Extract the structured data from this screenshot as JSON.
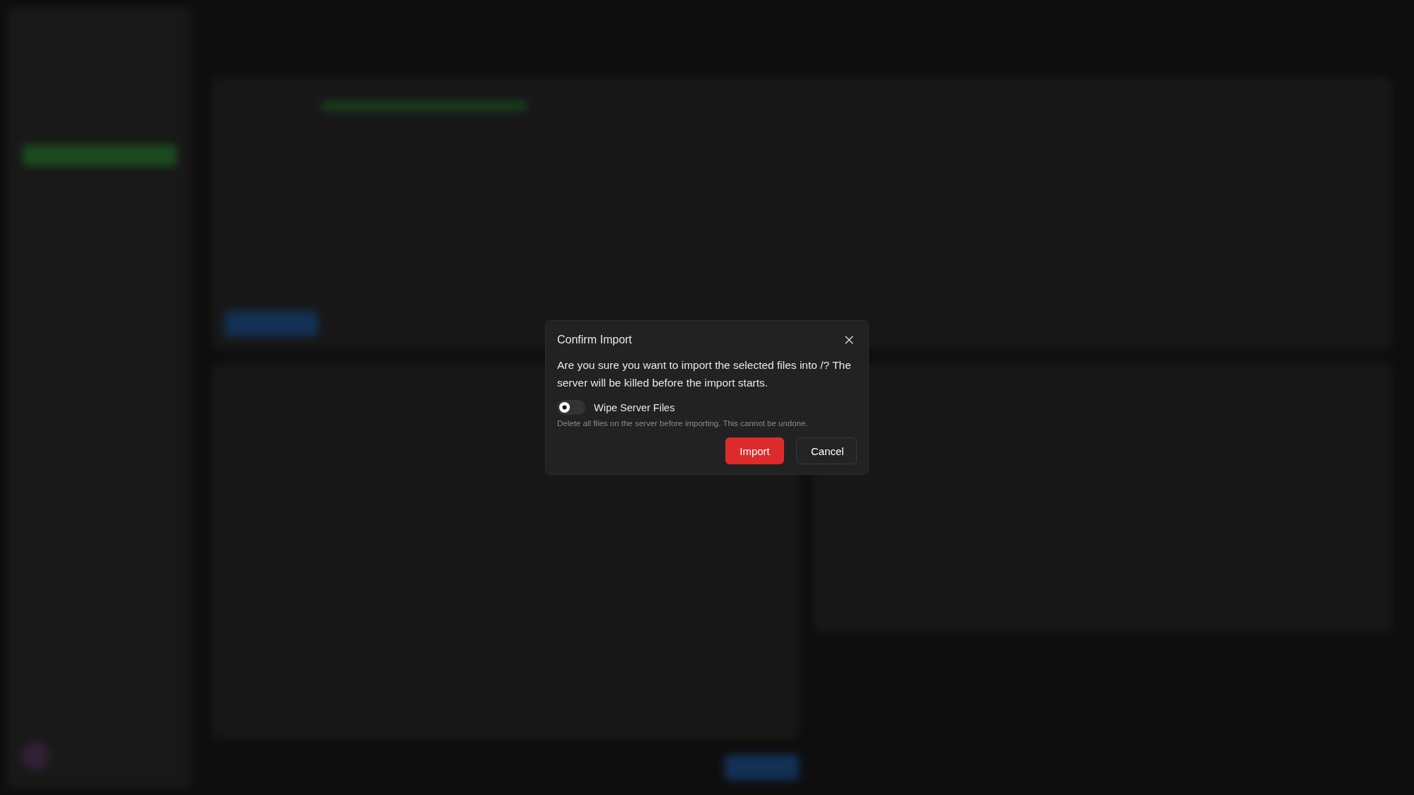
{
  "dialog": {
    "title": "Confirm Import",
    "message": "Are you sure you want to import the selected files into /? The server will be killed before the import starts.",
    "toggle": {
      "label": "Wipe Server Files",
      "on": false,
      "hint": "Delete all files on the server before importing. This cannot be undone."
    },
    "buttons": [
      {
        "label": "Import",
        "kind": "danger"
      },
      {
        "label": "Cancel",
        "kind": "secondary"
      }
    ]
  }
}
